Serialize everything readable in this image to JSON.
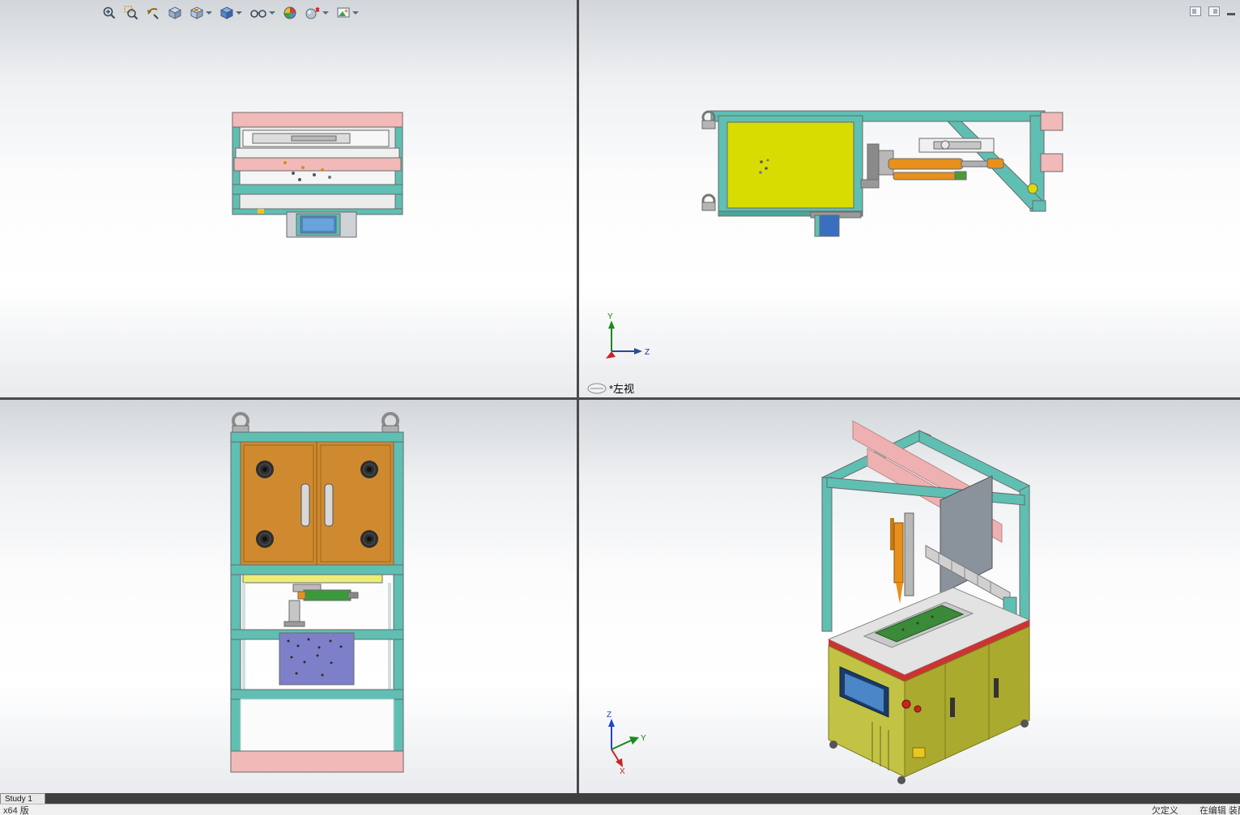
{
  "app": {
    "type": "cad-assembly-four-view"
  },
  "toolbar": {
    "icons": [
      "zoom-to-fit-icon",
      "zoom-to-area-icon",
      "previous-view-icon",
      "section-view-icon",
      "view-orientation-icon",
      "display-style-icon",
      "hide-show-items-icon",
      "edit-appearance-icon",
      "apply-scene-icon",
      "view-settings-icon"
    ]
  },
  "window_controls": [
    "pane-toggle-icon",
    "pane-toggle-2-icon",
    "minimize-icon"
  ],
  "viewports": {
    "top_left": {
      "view": "top"
    },
    "top_right": {
      "view": "left",
      "label": "*左视"
    },
    "bottom_left": {
      "view": "front"
    },
    "bottom_right": {
      "view": "isometric"
    }
  },
  "triad": {
    "x": "X",
    "y": "Y",
    "z": "Z"
  },
  "status_bar": {
    "tab": "Study 1",
    "system": "x64 版",
    "state": "欠定义",
    "mode": "在编辑 装配"
  },
  "colors": {
    "frame_teal": "#5fbfb3",
    "bumper_pink": "#f2b9b9",
    "panel_yellow": "#d9dc00",
    "door_orange": "#cf8a30",
    "panel_purple": "#7d80c8",
    "screen_blue": "#4a86c8",
    "actuator_orange": "#e8901c",
    "cabinet_olive": "#b8bc38",
    "edge_red": "#cc3333",
    "divider_gray": "#4a4a4a"
  }
}
